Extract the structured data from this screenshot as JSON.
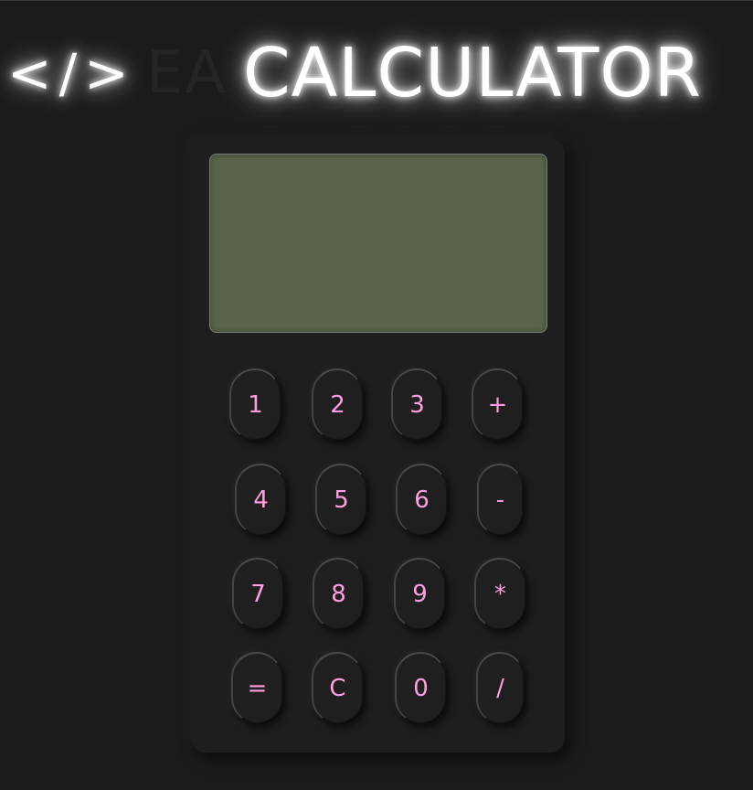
{
  "header": {
    "code_icon": "</>",
    "dim_text": "EA",
    "title": "CALCULATOR"
  },
  "display": {
    "value": ""
  },
  "keys": {
    "k1": "1",
    "k2": "2",
    "k3": "3",
    "plus": "+",
    "k4": "4",
    "k5": "5",
    "k6": "6",
    "minus": "-",
    "k7": "7",
    "k8": "8",
    "k9": "9",
    "multiply": "*",
    "equals": "=",
    "clear": "C",
    "k0": "0",
    "divide": "/"
  },
  "colors": {
    "background": "#1b1b1b",
    "display": "#59644a",
    "key_text": "#ff9ee0",
    "glow_text": "#ffffff"
  }
}
